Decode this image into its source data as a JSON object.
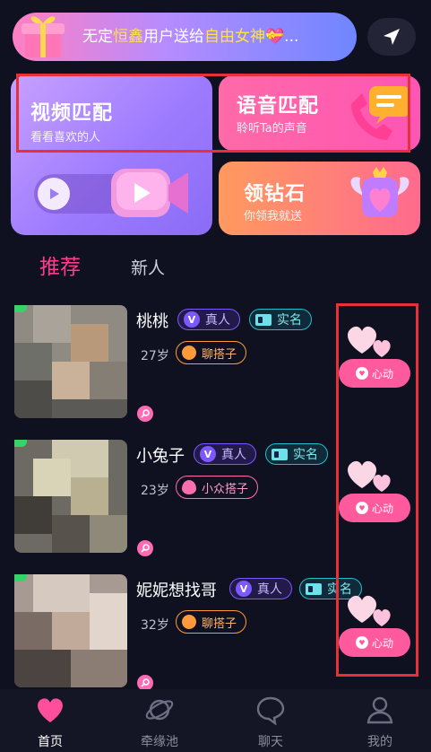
{
  "banner": {
    "prefix": "无定",
    "name_highlight": "恒鑫",
    "middle": "用户送给",
    "gift_highlight": "自由女神",
    "suffix": "💝..."
  },
  "cards": {
    "video": {
      "title": "视频匹配",
      "subtitle": "看看喜欢的人"
    },
    "voice": {
      "title": "语音匹配",
      "subtitle": "聆听Ta的声音"
    },
    "diamond": {
      "title": "领钻石",
      "subtitle": "你领我就送"
    }
  },
  "tabs": [
    {
      "label": "推荐",
      "active": true
    },
    {
      "label": "新人",
      "active": false
    }
  ],
  "users": [
    {
      "name": "桃桃",
      "verified_label": "真人",
      "real_label": "实名",
      "age": "27岁",
      "interest": "聊搭子",
      "interest_color": "orange",
      "like_label": "心动"
    },
    {
      "name": "小兔子",
      "verified_label": "真人",
      "real_label": "实名",
      "age": "23岁",
      "interest": "小众搭子",
      "interest_color": "pink",
      "like_label": "心动"
    },
    {
      "name": "妮妮想找哥",
      "verified_label": "真人",
      "real_label": "实名",
      "age": "32岁",
      "interest": "聊搭子",
      "interest_color": "orange",
      "like_label": "心动"
    }
  ],
  "nav": [
    {
      "label": "首页",
      "icon": "heart-icon",
      "active": true
    },
    {
      "label": "牵缘池",
      "icon": "planet-icon",
      "active": false
    },
    {
      "label": "聊天",
      "icon": "chat-bubble-icon",
      "active": false
    },
    {
      "label": "我的",
      "icon": "person-icon",
      "active": false
    }
  ],
  "colors": {
    "background": "#0f1020",
    "accent_pink": "#ff3d8b",
    "highlight_box": "#e8303a"
  }
}
